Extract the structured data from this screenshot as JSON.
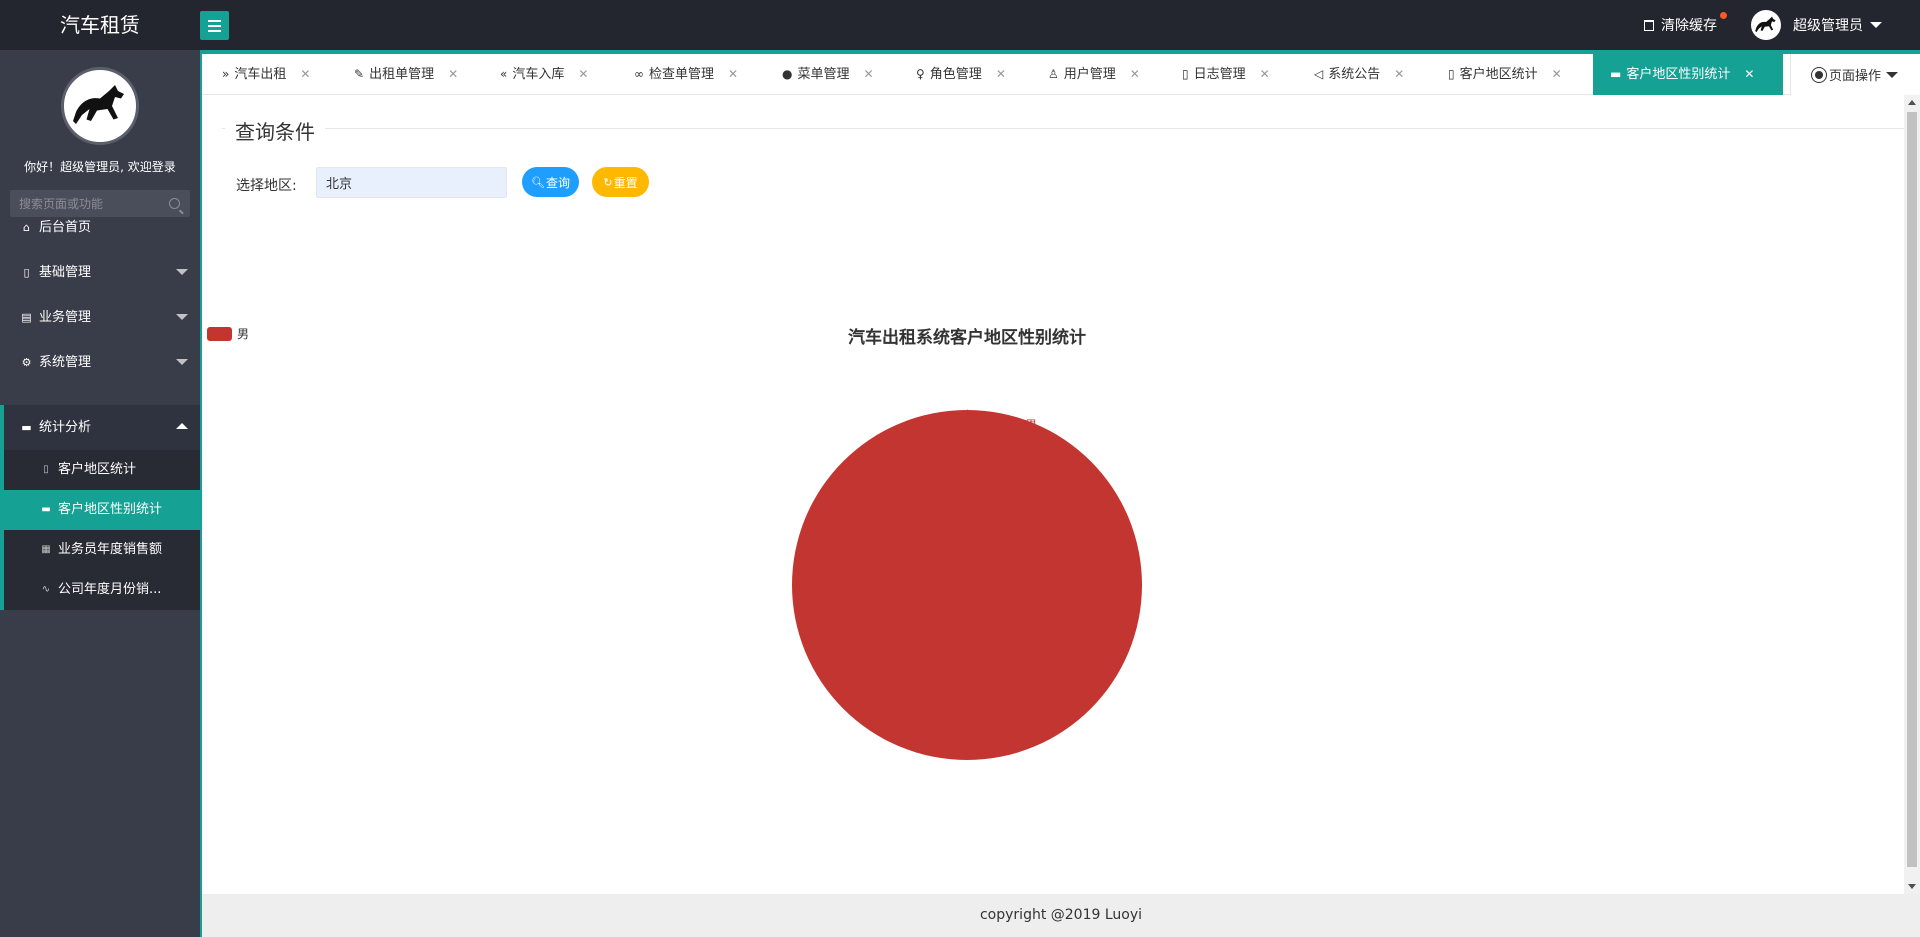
{
  "app": {
    "title": "汽车租赁"
  },
  "header": {
    "clear_cache": "清除缓存",
    "user_name": "超级管理员",
    "menu_icon": "hamburger-icon",
    "trash_icon": "trash-icon"
  },
  "sidebar": {
    "welcome": "你好！超级管理员, 欢迎登录",
    "search_placeholder": "搜索页面或功能",
    "items": [
      {
        "label": "后台首页",
        "icon": "home-icon"
      },
      {
        "label": "基础管理",
        "icon": "file-icon"
      },
      {
        "label": "业务管理",
        "icon": "book-icon"
      },
      {
        "label": "系统管理",
        "icon": "gear-icon"
      },
      {
        "label": "统计分析",
        "icon": "chart-icon"
      }
    ],
    "sub_items": [
      {
        "label": "客户地区统计",
        "icon": "doc-icon"
      },
      {
        "label": "客户地区性别统计",
        "icon": "chart-icon"
      },
      {
        "label": "业务员年度销售额",
        "icon": "table-icon"
      },
      {
        "label": "公司年度月份销...",
        "icon": "pulse-icon"
      }
    ]
  },
  "tabs": [
    {
      "label": "汽车出租",
      "icon": "double-right-icon"
    },
    {
      "label": "出租单管理",
      "icon": "edit-icon"
    },
    {
      "label": "汽车入库",
      "icon": "double-left-icon"
    },
    {
      "label": "检查单管理",
      "icon": "binoculars-icon"
    },
    {
      "label": "菜单管理",
      "icon": "circle-menu-icon"
    },
    {
      "label": "角色管理",
      "icon": "user-icon"
    },
    {
      "label": "用户管理",
      "icon": "users-icon"
    },
    {
      "label": "日志管理",
      "icon": "note-icon"
    },
    {
      "label": "系统公告",
      "icon": "speaker-icon"
    },
    {
      "label": "客户地区统计",
      "icon": "doc-icon"
    },
    {
      "label": "客户地区性别统计",
      "icon": "chart-icon"
    }
  ],
  "page_op": "页面操作",
  "query": {
    "legend": "查询条件",
    "region_label": "选择地区:",
    "region_value": "北京",
    "query_button": "查询",
    "reset_button": "重置"
  },
  "chart_data": {
    "type": "pie",
    "title": "汽车出租系统客户地区性别统计",
    "legend_position": "top-left",
    "slices": [
      {
        "name": "男",
        "value": 1,
        "color": "#c23531"
      }
    ]
  },
  "footer": {
    "copyright": "copyright @2019 Luoyi"
  }
}
